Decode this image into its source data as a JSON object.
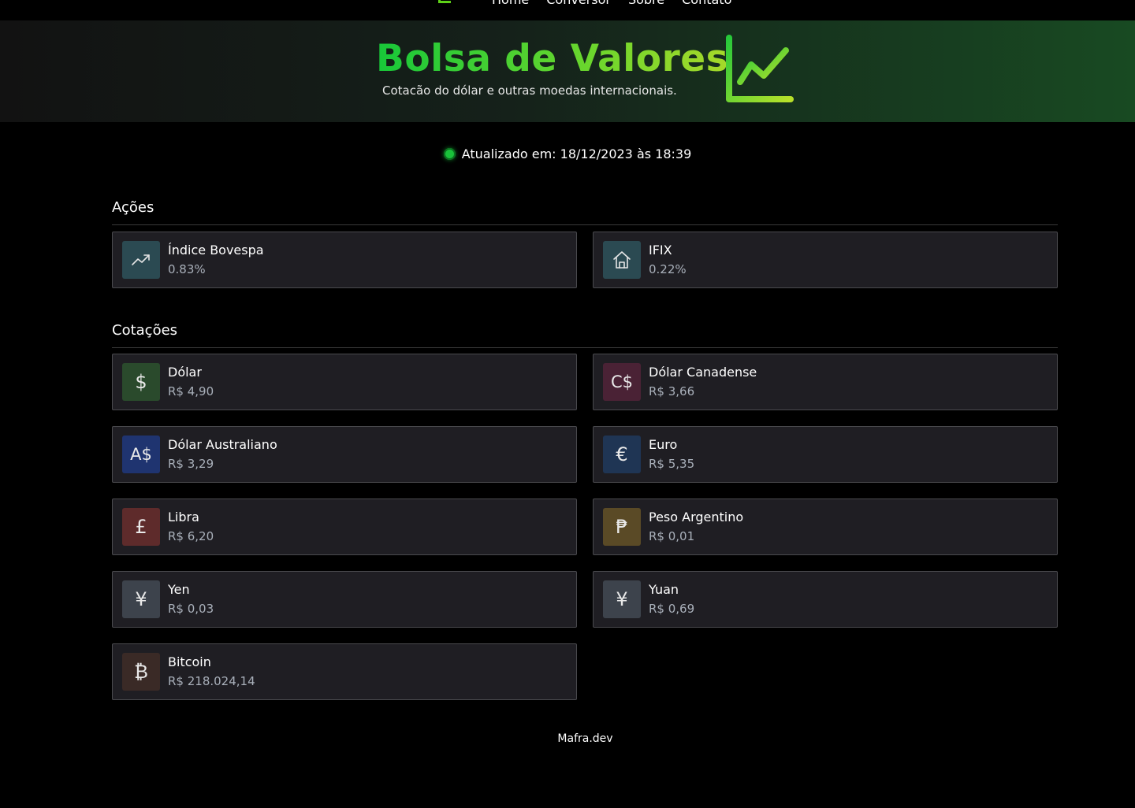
{
  "nav": {
    "links": [
      "Home",
      "Conversor",
      "Sobre",
      "Contato"
    ]
  },
  "hero": {
    "title": "Bolsa de Valores",
    "subtitle": "Cotacão do dólar e outras moedas internacionais."
  },
  "status": {
    "text": "Atualizado em: 18/12/2023 às 18:39",
    "color": "#19c23a"
  },
  "acoes": {
    "title": "Ações",
    "items": [
      {
        "name": "Índice Bovespa",
        "value": "0.83%",
        "icon": "trending-up-icon",
        "color": "#2b4a52"
      },
      {
        "name": "IFIX",
        "value": "0.22%",
        "icon": "home-icon",
        "color": "#2b4a52"
      }
    ]
  },
  "cotacoes": {
    "title": "Cotações",
    "items": [
      {
        "name": "Dólar",
        "value": "R$ 4,90",
        "symbol": "$",
        "icon": "dollar-icon",
        "color": "#2a4a2c"
      },
      {
        "name": "Dólar Canadense",
        "value": "R$ 3,66",
        "symbol": "C$",
        "icon": "canadian-dollar-icon",
        "color": "#4a2235"
      },
      {
        "name": "Dólar Australiano",
        "value": "R$ 3,29",
        "symbol": "A$",
        "icon": "australian-dollar-icon",
        "color": "#1f3470"
      },
      {
        "name": "Euro",
        "value": "R$ 5,35",
        "symbol": "€",
        "icon": "euro-icon",
        "color": "#1f3554"
      },
      {
        "name": "Libra",
        "value": "R$ 6,20",
        "symbol": "£",
        "icon": "pound-icon",
        "color": "#5e2b2b"
      },
      {
        "name": "Peso Argentino",
        "value": "R$ 0,01",
        "symbol": "₱",
        "icon": "peso-icon",
        "color": "#5a4a26"
      },
      {
        "name": "Yen",
        "value": "R$ 0,03",
        "symbol": "¥",
        "icon": "yen-icon",
        "color": "#3d434c"
      },
      {
        "name": "Yuan",
        "value": "R$ 0,69",
        "symbol": "¥",
        "icon": "yuan-icon",
        "color": "#3d434c"
      },
      {
        "name": "Bitcoin",
        "value": "R$ 218.024,14",
        "symbol": "₿",
        "icon": "bitcoin-icon",
        "color": "#3a2a26"
      }
    ]
  },
  "footer": {
    "text": "Mafra.dev"
  }
}
